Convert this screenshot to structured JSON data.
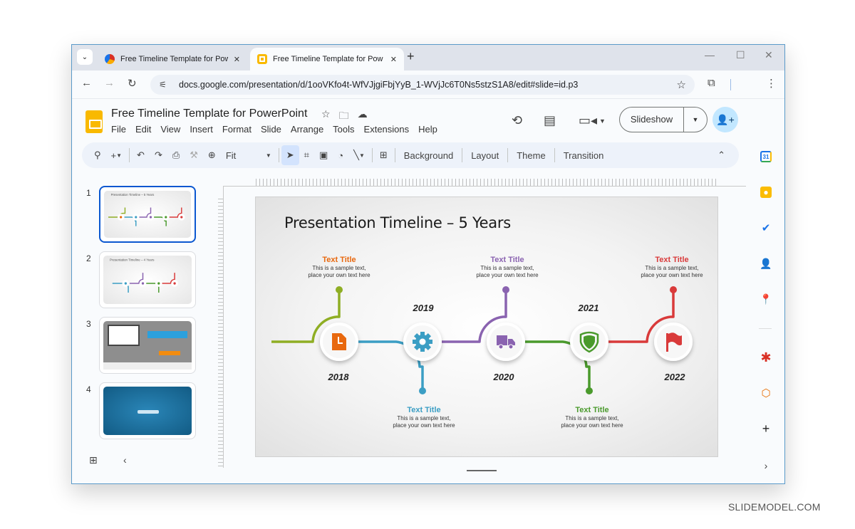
{
  "browser": {
    "tabs": [
      {
        "title": "Free Timeline Template for Pow",
        "active": false,
        "favicon": "slidemodel-favicon"
      },
      {
        "title": "Free Timeline Template for Pow",
        "active": true,
        "favicon": "google-slides-favicon"
      }
    ],
    "new_tab": "+",
    "tab_close": "✕",
    "window_controls": {
      "minimize": "—",
      "maximize": "☐",
      "close": "✕"
    },
    "url": "docs.google.com/presentation/d/1ooVKfo4t-WfVJjgiFbjYyB_1-WVjJc6T0Ns5stzS1A8/edit#slide=id.p3"
  },
  "docs": {
    "title": "Free Timeline Template for PowerPoint",
    "menu": [
      "File",
      "Edit",
      "View",
      "Insert",
      "Format",
      "Slide",
      "Arrange",
      "Tools",
      "Extensions",
      "Help"
    ],
    "slideshow_label": "Slideshow",
    "toolbar": {
      "zoom_value": "Fit",
      "text_buttons": [
        "Background",
        "Layout",
        "Theme",
        "Transition"
      ]
    }
  },
  "filmstrip": {
    "slides": [
      {
        "number": "1",
        "selected": true,
        "kind": "timeline-5-years"
      },
      {
        "number": "2",
        "selected": false,
        "kind": "timeline-4-years"
      },
      {
        "number": "3",
        "selected": false,
        "kind": "promo"
      },
      {
        "number": "4",
        "selected": false,
        "kind": "closing"
      }
    ]
  },
  "slide": {
    "title": "Presentation Timeline – 5 Years",
    "milestones": [
      {
        "year": "2018",
        "color": "#8fae24",
        "node_color": "#e8680e",
        "icon": "document-icon",
        "callout_position": "top",
        "callout": {
          "title": "Text Title",
          "title_color": "#e8680e",
          "line1": "This is a sample text,",
          "line2": "place your own text here"
        }
      },
      {
        "year": "2019",
        "color": "#3b9ec4",
        "node_color": "#3b9ec4",
        "icon": "gear-icon",
        "callout_position": "bottom",
        "callout": {
          "title": "Text Title",
          "title_color": "#3b9ec4",
          "line1": "This is a sample text,",
          "line2": "place your own text here"
        }
      },
      {
        "year": "2020",
        "color": "#8a63b0",
        "node_color": "#8a63b0",
        "icon": "truck-icon",
        "callout_position": "top",
        "callout": {
          "title": "Text Title",
          "title_color": "#8a63b0",
          "line1": "This is a sample text,",
          "line2": "place your own text here"
        }
      },
      {
        "year": "2021",
        "color": "#4a9a2c",
        "node_color": "#4a9a2c",
        "icon": "shield-icon",
        "callout_position": "bottom",
        "callout": {
          "title": "Text Title",
          "title_color": "#4a9a2c",
          "line1": "This is a sample text,",
          "line2": "place your own text here"
        }
      },
      {
        "year": "2022",
        "color": "#d93a3a",
        "node_color": "#d93a3a",
        "icon": "flag-icon",
        "callout_position": "top",
        "callout": {
          "title": "Text Title",
          "title_color": "#d93a3a",
          "line1": "This is a sample text,",
          "line2": "place your own text here"
        }
      }
    ]
  },
  "side_panel": [
    "calendar-icon",
    "keep-icon",
    "tasks-icon",
    "contacts-icon",
    "maps-icon",
    "asterisk-addon-icon",
    "office-addon-icon",
    "add-addon-icon"
  ],
  "watermark": "SLIDEMODEL.COM",
  "colors": {
    "accent": "#0b57d0",
    "share_bg": "#c2e7ff",
    "toolbar_bg": "#edf2fa"
  }
}
